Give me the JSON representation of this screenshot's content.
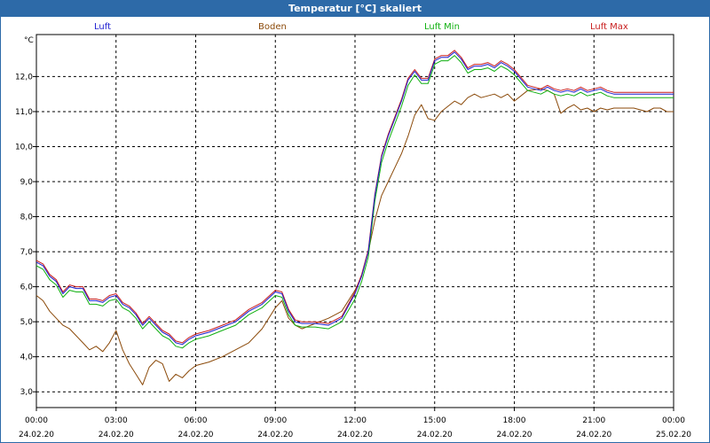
{
  "window": {
    "title": "Temperatur [°C] skaliert"
  },
  "chart_data": {
    "type": "line",
    "ylabel": "°C",
    "yticks": [
      "3,0",
      "4,0",
      "5,0",
      "6,0",
      "7,0",
      "8,0",
      "9,0",
      "10,0",
      "11,0",
      "12,0"
    ],
    "ylim": [
      2.55,
      13.2
    ],
    "xlim": [
      0,
      24
    ],
    "xticks": [
      {
        "time": "00:00",
        "date": "24.02.20"
      },
      {
        "time": "03:00",
        "date": "24.02.20"
      },
      {
        "time": "06:00",
        "date": "24.02.20"
      },
      {
        "time": "09:00",
        "date": "24.02.20"
      },
      {
        "time": "12:00",
        "date": "24.02.20"
      },
      {
        "time": "15:00",
        "date": "24.02.20"
      },
      {
        "time": "18:00",
        "date": "24.02.20"
      },
      {
        "time": "21:00",
        "date": "24.02.20"
      },
      {
        "time": "00:00",
        "date": "25.02.20"
      }
    ],
    "grid": true,
    "legend_position": "top",
    "series": [
      {
        "name": "Luft",
        "color": "#1f1fd0",
        "x": [
          0,
          0.25,
          0.5,
          0.75,
          1,
          1.25,
          1.5,
          1.75,
          2,
          2.25,
          2.5,
          2.75,
          3,
          3.25,
          3.5,
          3.75,
          4,
          4.25,
          4.5,
          4.75,
          5,
          5.25,
          5.5,
          5.75,
          6,
          6.5,
          7,
          7.5,
          8,
          8.5,
          9,
          9.25,
          9.5,
          9.75,
          10,
          10.5,
          11,
          11.5,
          12,
          12.25,
          12.5,
          12.75,
          13,
          13.25,
          13.5,
          13.75,
          14,
          14.25,
          14.5,
          14.75,
          15,
          15.25,
          15.5,
          15.75,
          16,
          16.25,
          16.5,
          16.75,
          17,
          17.25,
          17.5,
          17.75,
          18,
          18.5,
          19,
          19.25,
          19.5,
          19.75,
          20,
          20.25,
          20.5,
          20.75,
          21,
          21.25,
          21.5,
          21.75,
          22,
          22.5,
          23,
          23.25,
          23.5,
          23.75,
          24
        ],
        "y": [
          6.7,
          6.6,
          6.3,
          6.15,
          5.8,
          6.0,
          5.95,
          5.95,
          5.6,
          5.6,
          5.55,
          5.7,
          5.75,
          5.5,
          5.4,
          5.2,
          4.9,
          5.1,
          4.9,
          4.7,
          4.6,
          4.4,
          4.35,
          4.5,
          4.6,
          4.7,
          4.85,
          5.0,
          5.3,
          5.5,
          5.85,
          5.8,
          5.3,
          5.0,
          4.95,
          4.95,
          4.9,
          5.1,
          5.8,
          6.3,
          7.0,
          8.6,
          9.7,
          10.3,
          10.8,
          11.3,
          11.9,
          12.15,
          11.9,
          11.9,
          12.45,
          12.55,
          12.55,
          12.7,
          12.5,
          12.2,
          12.3,
          12.3,
          12.35,
          12.25,
          12.4,
          12.3,
          12.15,
          11.7,
          11.6,
          11.7,
          11.6,
          11.55,
          11.6,
          11.55,
          11.65,
          11.55,
          11.6,
          11.65,
          11.55,
          11.5,
          11.5,
          11.5,
          11.5,
          11.5,
          11.5,
          11.5,
          11.5
        ]
      },
      {
        "name": "Boden",
        "color": "#8b4a0a",
        "x": [
          0,
          0.25,
          0.5,
          0.75,
          1,
          1.25,
          1.5,
          1.75,
          2,
          2.25,
          2.5,
          2.75,
          3,
          3.25,
          3.5,
          3.75,
          4,
          4.25,
          4.5,
          4.75,
          5,
          5.25,
          5.5,
          5.75,
          6,
          6.5,
          7,
          7.5,
          8,
          8.5,
          9,
          9.25,
          9.5,
          9.75,
          10,
          10.5,
          11,
          11.5,
          12,
          12.25,
          12.5,
          12.75,
          13,
          13.25,
          13.5,
          13.75,
          14,
          14.25,
          14.5,
          14.75,
          15,
          15.25,
          15.5,
          15.75,
          16,
          16.25,
          16.5,
          16.75,
          17,
          17.25,
          17.5,
          17.75,
          18,
          18.5,
          19,
          19.25,
          19.5,
          19.75,
          20,
          20.25,
          20.5,
          20.75,
          21,
          21.25,
          21.5,
          21.75,
          22,
          22.5,
          23,
          23.25,
          23.5,
          23.75,
          24
        ],
        "y": [
          5.75,
          5.6,
          5.3,
          5.1,
          4.9,
          4.8,
          4.6,
          4.4,
          4.2,
          4.3,
          4.15,
          4.4,
          4.75,
          4.2,
          3.8,
          3.5,
          3.2,
          3.7,
          3.9,
          3.8,
          3.3,
          3.5,
          3.4,
          3.6,
          3.75,
          3.85,
          4.0,
          4.2,
          4.4,
          4.8,
          5.4,
          5.6,
          5.1,
          4.9,
          4.8,
          4.95,
          5.1,
          5.3,
          5.9,
          6.3,
          7.0,
          7.9,
          8.6,
          9.0,
          9.4,
          9.8,
          10.3,
          10.9,
          11.2,
          10.8,
          10.75,
          11.0,
          11.15,
          11.3,
          11.2,
          11.4,
          11.5,
          11.4,
          11.45,
          11.5,
          11.4,
          11.5,
          11.3,
          11.6,
          11.65,
          11.6,
          11.5,
          10.95,
          11.1,
          11.2,
          11.05,
          11.1,
          11.0,
          11.1,
          11.05,
          11.1,
          11.1,
          11.1,
          11.0,
          11.1,
          11.1,
          11.0,
          11.0
        ]
      },
      {
        "name": "Luft Min",
        "color": "#10b010",
        "x": [
          0,
          0.25,
          0.5,
          0.75,
          1,
          1.25,
          1.5,
          1.75,
          2,
          2.25,
          2.5,
          2.75,
          3,
          3.25,
          3.5,
          3.75,
          4,
          4.25,
          4.5,
          4.75,
          5,
          5.25,
          5.5,
          5.75,
          6,
          6.5,
          7,
          7.5,
          8,
          8.5,
          9,
          9.25,
          9.5,
          9.75,
          10,
          10.5,
          11,
          11.5,
          12,
          12.25,
          12.5,
          12.75,
          13,
          13.25,
          13.5,
          13.75,
          14,
          14.25,
          14.5,
          14.75,
          15,
          15.25,
          15.5,
          15.75,
          16,
          16.25,
          16.5,
          16.75,
          17,
          17.25,
          17.5,
          17.75,
          18,
          18.5,
          19,
          19.25,
          19.5,
          19.75,
          20,
          20.25,
          20.5,
          20.75,
          21,
          21.25,
          21.5,
          21.75,
          22,
          22.5,
          23,
          23.25,
          23.5,
          23.75,
          24
        ],
        "y": [
          6.6,
          6.5,
          6.2,
          6.05,
          5.7,
          5.9,
          5.85,
          5.85,
          5.5,
          5.5,
          5.45,
          5.6,
          5.65,
          5.4,
          5.3,
          5.1,
          4.8,
          5.0,
          4.8,
          4.6,
          4.5,
          4.3,
          4.25,
          4.4,
          4.5,
          4.6,
          4.75,
          4.9,
          5.2,
          5.4,
          5.75,
          5.7,
          5.2,
          4.9,
          4.85,
          4.85,
          4.8,
          5.0,
          5.65,
          6.15,
          6.85,
          8.45,
          9.55,
          10.15,
          10.65,
          11.15,
          11.75,
          12.05,
          11.8,
          11.8,
          12.35,
          12.45,
          12.45,
          12.6,
          12.4,
          12.1,
          12.2,
          12.2,
          12.25,
          12.15,
          12.3,
          12.2,
          12.05,
          11.6,
          11.5,
          11.6,
          11.5,
          11.45,
          11.5,
          11.45,
          11.55,
          11.45,
          11.5,
          11.55,
          11.45,
          11.4,
          11.4,
          11.4,
          11.4,
          11.4,
          11.4,
          11.4,
          11.4
        ]
      },
      {
        "name": "Luft Max",
        "color": "#c81e1e",
        "x": [
          0,
          0.25,
          0.5,
          0.75,
          1,
          1.25,
          1.5,
          1.75,
          2,
          2.25,
          2.5,
          2.75,
          3,
          3.25,
          3.5,
          3.75,
          4,
          4.25,
          4.5,
          4.75,
          5,
          5.25,
          5.5,
          5.75,
          6,
          6.5,
          7,
          7.5,
          8,
          8.5,
          9,
          9.25,
          9.5,
          9.75,
          10,
          10.5,
          11,
          11.5,
          12,
          12.25,
          12.5,
          12.75,
          13,
          13.25,
          13.5,
          13.75,
          14,
          14.25,
          14.5,
          14.75,
          15,
          15.25,
          15.5,
          15.75,
          16,
          16.25,
          16.5,
          16.75,
          17,
          17.25,
          17.5,
          17.75,
          18,
          18.5,
          19,
          19.25,
          19.5,
          19.75,
          20,
          20.25,
          20.5,
          20.75,
          21,
          21.25,
          21.5,
          21.75,
          22,
          22.5,
          23,
          23.25,
          23.5,
          23.75,
          24
        ],
        "y": [
          6.75,
          6.65,
          6.35,
          6.2,
          5.85,
          6.05,
          6.0,
          6.0,
          5.65,
          5.65,
          5.6,
          5.75,
          5.8,
          5.55,
          5.45,
          5.25,
          4.95,
          5.15,
          4.95,
          4.75,
          4.65,
          4.45,
          4.4,
          4.55,
          4.65,
          4.75,
          4.9,
          5.05,
          5.35,
          5.55,
          5.9,
          5.85,
          5.35,
          5.05,
          5.0,
          5.0,
          4.95,
          5.15,
          5.85,
          6.35,
          7.05,
          8.65,
          9.75,
          10.35,
          10.85,
          11.35,
          11.95,
          12.2,
          11.95,
          11.95,
          12.5,
          12.6,
          12.6,
          12.75,
          12.55,
          12.25,
          12.35,
          12.35,
          12.4,
          12.3,
          12.45,
          12.35,
          12.2,
          11.75,
          11.65,
          11.75,
          11.65,
          11.6,
          11.65,
          11.6,
          11.7,
          11.6,
          11.65,
          11.7,
          11.6,
          11.55,
          11.55,
          11.55,
          11.55,
          11.55,
          11.55,
          11.55,
          11.55
        ]
      }
    ]
  }
}
